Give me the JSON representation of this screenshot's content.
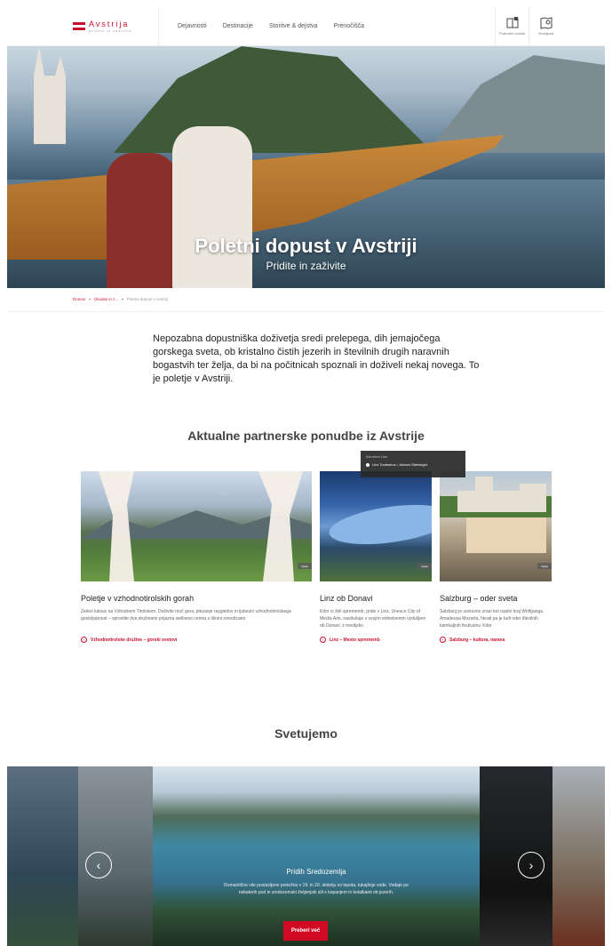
{
  "header": {
    "logo_main": "Avstrija",
    "logo_sub": "pridite in zaživite",
    "nav": [
      "Dejavnosti",
      "Destinacije",
      "Storitve & dejstva",
      "Prenočišča"
    ],
    "tools": [
      {
        "label": "Podrobni vodnik",
        "icon": "map-book-icon"
      },
      {
        "label": "Zemljevid",
        "icon": "map-pin-icon"
      }
    ]
  },
  "hero": {
    "title": "Poletni dopust v Avstriji",
    "subtitle": "Pridite in zaživite"
  },
  "breadcrumb": {
    "items": [
      "Domov",
      "Izkusite in z...",
      "Poletni dopust v Avstriji"
    ]
  },
  "intro": "Nepozabna dopustniška doživetja sredi prelepega, dih jemajočega gorskega sveta, ob kristalno čistih jezerih in številnih drugih naravnih bogastvih ter želja, da bi na počitnicah spoznali in doživeli nekaj novega. To je poletje v Avstriji.",
  "offers": {
    "heading": "Aktualne partnerske ponudbe iz Avstrije",
    "tooltip": {
      "title": "Ars elect Linz",
      "credit": "Linz Tourismus / Johann Steininger"
    },
    "cards": [
      {
        "title": "Poletje v vzhodnotirolskih gorah",
        "text": "Zeleni luksuz na Vzhodnem Tirolskem. Doživite moč gora, plezanje razgledov in ljubezio vzhodnotirolskega gostoljubnost – sprostite dva družinami prijazna wellness centra s lišnini zvezdicami",
        "link": "Vzhodnotirolske družine – gorski svetovi",
        "badge": "Oglas"
      },
      {
        "title": "Linz ob Donavi",
        "text": "Kdor si želi sprememb, pride v Linz, Unesco City of Media Arts, navdušuje s svojim edinstvenim vzdušjem ob Donavi, z medijsko",
        "link": "Linz – Mesto sprememb",
        "badge": "Oglas"
      },
      {
        "title": "Salzburg – oder sveta",
        "text": "Salzburg je svetovno znan kot rojstni kraj Wolfganga Amadeusa Mozarta, hkrati pa je tudi oder številnih kamkaljnih festivalov. Kdor",
        "link": "Salzburg – kultura, narava",
        "badge": "Oglas"
      }
    ]
  },
  "recommend": {
    "heading": "Svetujemo",
    "slide_title": "Pridih Sredozemlja",
    "slide_text": "Romantične vile postavljene pretežno v 19. in 20. stoletju so lepota, tukajšnje vode. Vodaje po nekaterih pod in sredozemski življenjski stil s kopanjem in kotalkami ob jezerih.",
    "button": "Preberi več"
  },
  "colors": {
    "accent": "#c8102e"
  }
}
